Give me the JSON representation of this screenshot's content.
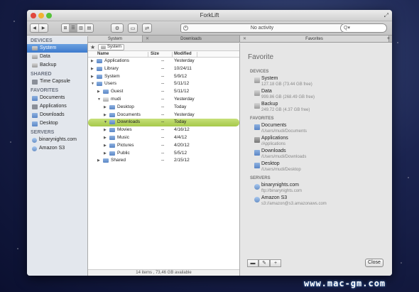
{
  "window": {
    "title": "ForkLift"
  },
  "toolbar": {
    "back_icon": "◀",
    "forward_icon": "▶",
    "view_icons": [
      "⊞",
      "☰",
      "▥",
      "▤"
    ],
    "action_icon": "⚙",
    "activity_label": "No activity",
    "search_placeholder": "Q▾"
  },
  "tabs": [
    {
      "label": "System"
    },
    {
      "label": "Downloads"
    },
    {
      "label": "Favorites"
    }
  ],
  "tab_add": "+",
  "sidebar": {
    "sections": [
      {
        "title": "DEVICES",
        "items": [
          {
            "label": "System",
            "icon": "drive-icon",
            "selected": true
          },
          {
            "label": "Data",
            "icon": "drive-icon"
          },
          {
            "label": "Backup",
            "icon": "drive-icon"
          }
        ]
      },
      {
        "title": "SHARED",
        "items": [
          {
            "label": "Time Capsule",
            "icon": "network-icon"
          }
        ]
      },
      {
        "title": "FAVORITES",
        "items": [
          {
            "label": "Documents",
            "icon": "folder-icon"
          },
          {
            "label": "Applications",
            "icon": "apps-icon"
          },
          {
            "label": "Downloads",
            "icon": "folder-icon"
          },
          {
            "label": "Desktop",
            "icon": "folder-icon"
          }
        ]
      },
      {
        "title": "SERVERS",
        "items": [
          {
            "label": "binarynights.com",
            "icon": "globe-icon"
          },
          {
            "label": "Amazon S3",
            "icon": "globe-icon"
          }
        ]
      }
    ]
  },
  "browser": {
    "star": "★",
    "path": "System",
    "columns": {
      "name": "Name",
      "size": "Size",
      "modified": "Modified"
    },
    "rows": [
      {
        "name": "Applications",
        "size": "--",
        "modified": "Yesterday",
        "depth": 0,
        "open": false
      },
      {
        "name": "Library",
        "size": "--",
        "modified": "10/24/11",
        "depth": 0,
        "open": false
      },
      {
        "name": "System",
        "size": "--",
        "modified": "5/9/12",
        "depth": 0,
        "open": false
      },
      {
        "name": "Users",
        "size": "--",
        "modified": "5/11/12",
        "depth": 0,
        "open": true
      },
      {
        "name": "Guest",
        "size": "--",
        "modified": "5/11/12",
        "depth": 1,
        "open": false
      },
      {
        "name": "mudi",
        "size": "--",
        "modified": "Yesterday",
        "depth": 1,
        "open": true,
        "home": true
      },
      {
        "name": "Desktop",
        "size": "--",
        "modified": "Today",
        "depth": 2,
        "open": false
      },
      {
        "name": "Documents",
        "size": "--",
        "modified": "Yesterday",
        "depth": 2,
        "open": false
      },
      {
        "name": "Downloads",
        "size": "--",
        "modified": "Today",
        "depth": 2,
        "open": true,
        "selected": true
      },
      {
        "name": "Movies",
        "size": "--",
        "modified": "4/16/12",
        "depth": 2,
        "open": false
      },
      {
        "name": "Music",
        "size": "--",
        "modified": "4/4/12",
        "depth": 2,
        "open": false
      },
      {
        "name": "Pictures",
        "size": "--",
        "modified": "4/20/12",
        "depth": 2,
        "open": false
      },
      {
        "name": "Public",
        "size": "--",
        "modified": "5/5/12",
        "depth": 2,
        "open": false
      },
      {
        "name": "Shared",
        "size": "--",
        "modified": "2/15/12",
        "depth": 1,
        "open": false
      }
    ],
    "status": "14 items , 73,46 GB available"
  },
  "favorites": {
    "title": "Favorite",
    "sections": [
      {
        "title": "DEVICES",
        "items": [
          {
            "name": "System",
            "detail": "127.18 GB (73.44 GB free)",
            "icon": "drive-icon"
          },
          {
            "name": "Data",
            "detail": "999.86 GB (268.49 GB free)",
            "icon": "drive-icon"
          },
          {
            "name": "Backup",
            "detail": "249.72 GB (4.37 GB free)",
            "icon": "drive-icon"
          }
        ]
      },
      {
        "title": "FAVORITES",
        "items": [
          {
            "name": "Documents",
            "detail": "/Users/mudi/Documents",
            "icon": "folder-icon"
          },
          {
            "name": "Applications",
            "detail": "/Applications",
            "icon": "apps-icon"
          },
          {
            "name": "Downloads",
            "detail": "/Users/mudi/Downloads",
            "icon": "folder-icon"
          },
          {
            "name": "Desktop",
            "detail": "/Users/mudi/Desktop",
            "icon": "folder-icon"
          }
        ]
      },
      {
        "title": "SERVERS",
        "items": [
          {
            "name": "binarynights.com",
            "detail": "ftp://binarynights.com",
            "icon": "globe-icon"
          },
          {
            "name": "Amazon S3",
            "detail": "s3://amazon@s3.amazonaws.com",
            "icon": "globe-icon"
          }
        ]
      }
    ],
    "footer_icons": [
      "▬",
      "✎",
      "+"
    ],
    "close_label": "Close"
  },
  "watermark": "www.mac-gm.com"
}
